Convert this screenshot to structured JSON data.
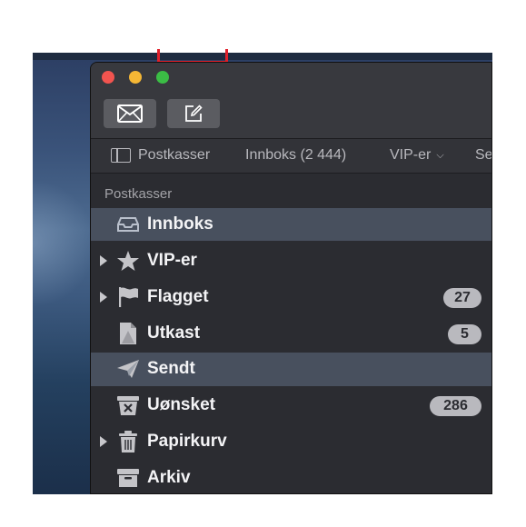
{
  "toolbar": {
    "get_mail_icon": "envelope-icon",
    "compose_icon": "compose-icon"
  },
  "favorites_bar": {
    "mailboxes_label": "Postkasser",
    "inbox_label": "Innboks (2 444)",
    "vip_label": "VIP-er",
    "more_label": "Se"
  },
  "sidebar": {
    "section_title": "Postkasser",
    "items": [
      {
        "label": "Innboks",
        "icon": "inbox-tray-icon",
        "selected": true
      },
      {
        "label": "VIP-er",
        "icon": "star-icon",
        "expandable": true
      },
      {
        "label": "Flagget",
        "icon": "flag-icon",
        "expandable": true,
        "badge": "27"
      },
      {
        "label": "Utkast",
        "icon": "drafts-icon",
        "badge": "5"
      },
      {
        "label": "Sendt",
        "icon": "paper-plane-icon",
        "selected": true
      },
      {
        "label": "Uønsket",
        "icon": "junk-bin-icon",
        "badge": "286"
      },
      {
        "label": "Papirkurv",
        "icon": "trash-icon",
        "expandable": true
      },
      {
        "label": "Arkiv",
        "icon": "archive-box-icon"
      }
    ]
  },
  "colors": {
    "window_bg": "#2b2c31",
    "selected_row": "#48505e",
    "badge_bg": "#b9b9be",
    "close": "#f2544f",
    "minimize": "#f5b735",
    "zoom": "#3bbd45",
    "highlight": "#e0202a"
  }
}
